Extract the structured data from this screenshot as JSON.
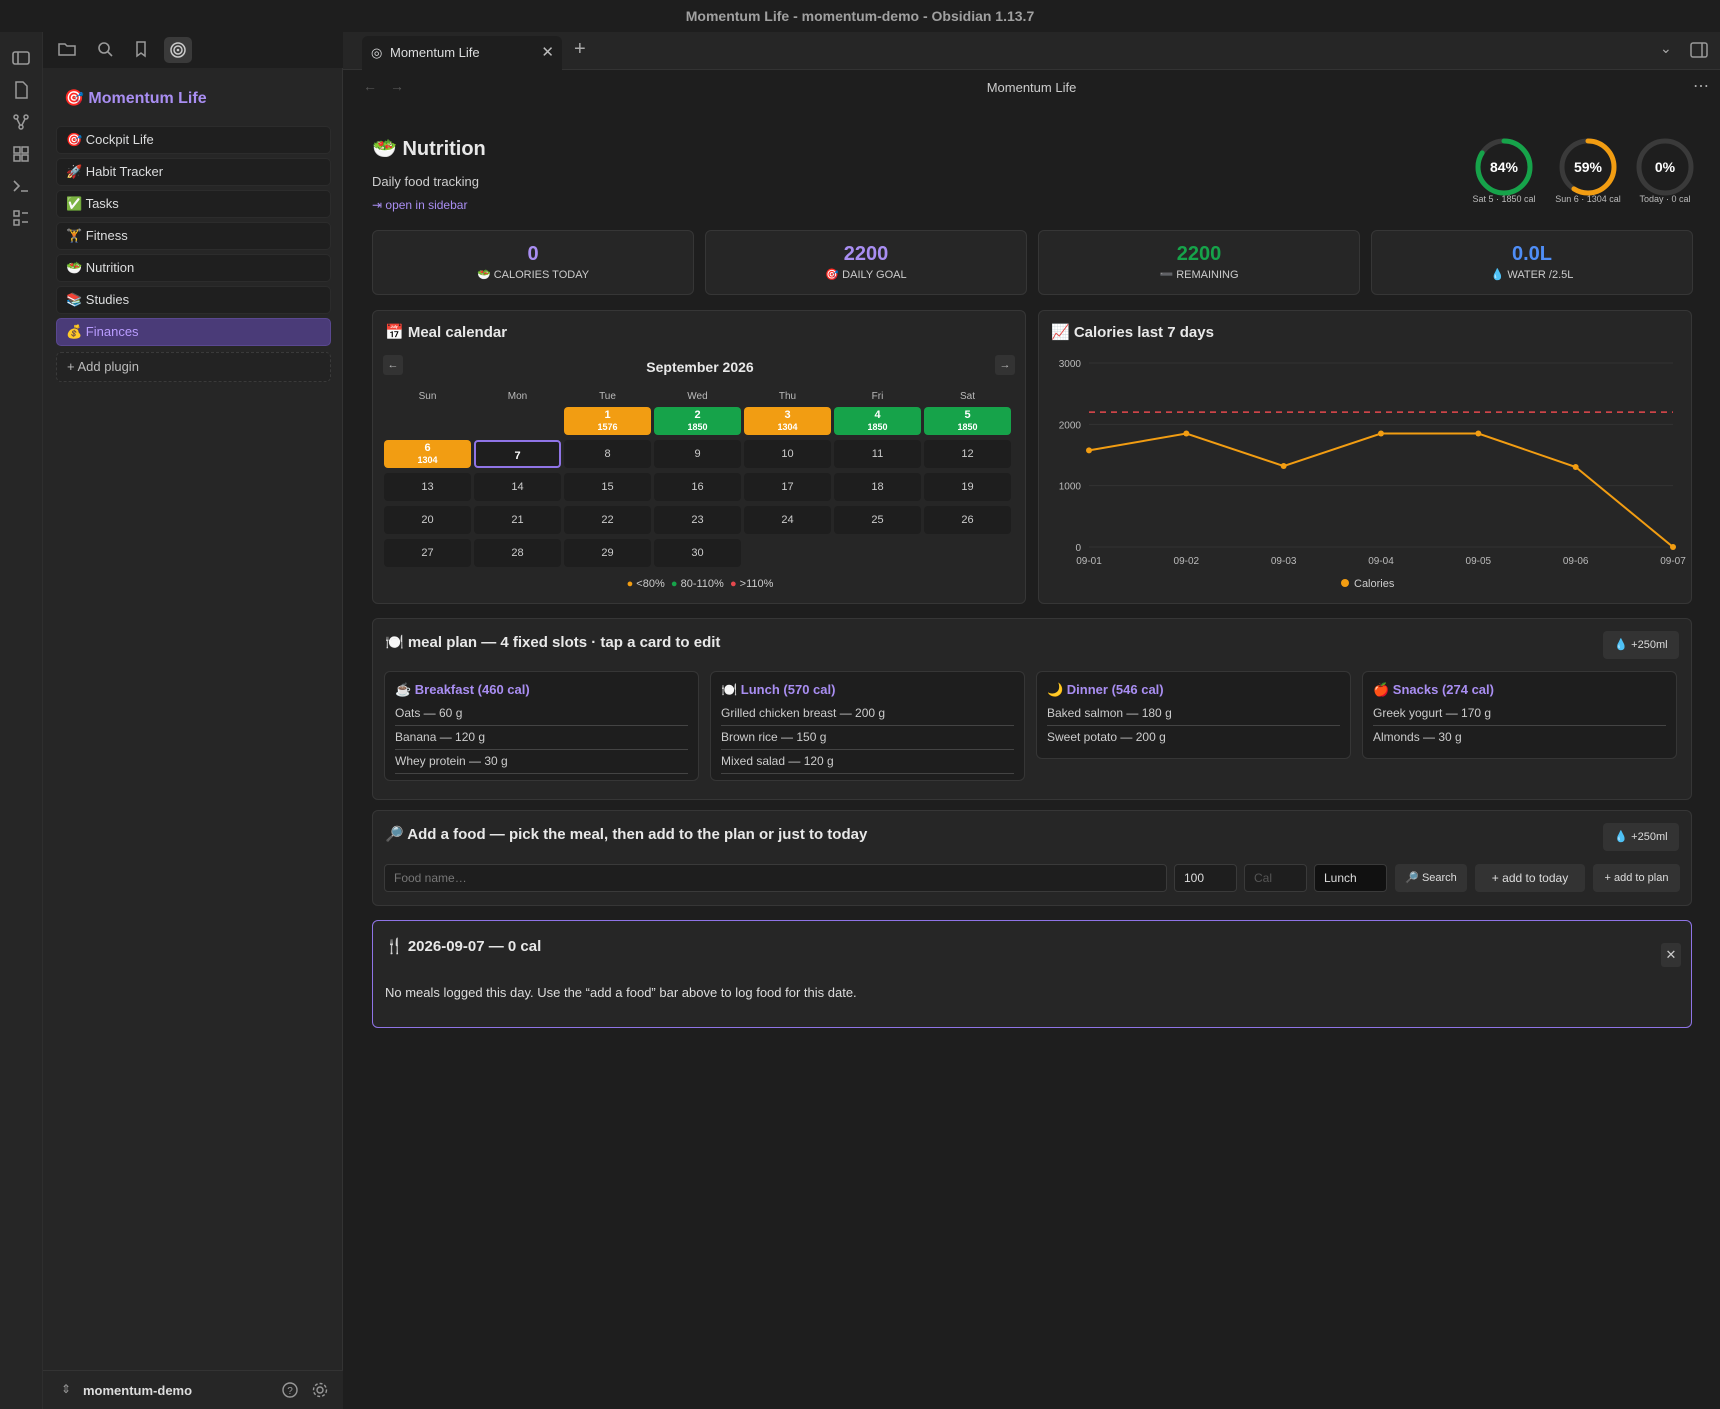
{
  "window": {
    "title": "Momentum Life - momentum-demo - Obsidian 1.13.7"
  },
  "tabs": [
    {
      "label": "Momentum Life"
    }
  ],
  "nav": {
    "title": "Momentum Life"
  },
  "sidebar": {
    "title": "🎯 Momentum Life",
    "items": [
      {
        "label": "🎯 Cockpit Life"
      },
      {
        "label": "🚀 Habit Tracker"
      },
      {
        "label": "✅ Tasks"
      },
      {
        "label": "🏋️ Fitness"
      },
      {
        "label": "🥗 Nutrition"
      },
      {
        "label": "📚 Studies"
      },
      {
        "label": "💰 Finances"
      }
    ],
    "add_label": "+ Add plugin",
    "vault": "momentum-demo"
  },
  "page": {
    "title": "🥗 Nutrition",
    "subtitle": "Daily food tracking",
    "open_link": "⇥ open in sidebar"
  },
  "rings": [
    {
      "pct": "84%",
      "value": 0.84,
      "label": "Sat 5 · 1850 cal",
      "color": "#16a34a"
    },
    {
      "pct": "59%",
      "value": 0.59,
      "label": "Sun 6 · 1304 cal",
      "color": "#f29d12"
    },
    {
      "pct": "0%",
      "value": 0,
      "label": "Today · 0 cal",
      "color": "#555555"
    }
  ],
  "stats": [
    {
      "value": "0",
      "label": "🥗 CALORIES TODAY",
      "color": "#a98ef2"
    },
    {
      "value": "2200",
      "label": "🎯 DAILY GOAL",
      "color": "#a98ef2"
    },
    {
      "value": "2200",
      "label": "➖ REMAINING",
      "color": "#16a34a"
    },
    {
      "value": "0.0L",
      "label": "💧 WATER /2.5L",
      "color": "#4f8ef7"
    }
  ],
  "calendar": {
    "title": "📅 Meal calendar",
    "month": "September 2026",
    "weekdays": [
      "Sun",
      "Mon",
      "Tue",
      "Wed",
      "Thu",
      "Fri",
      "Sat"
    ],
    "legend": [
      "<80%",
      "80-110%",
      ">110%"
    ]
  },
  "chart_data": {
    "type": "line",
    "title": "📈 Calories last 7 days",
    "x": [
      "09-01",
      "09-02",
      "09-03",
      "09-04",
      "09-05",
      "09-06",
      "09-07"
    ],
    "series": [
      {
        "name": "Calories",
        "values": [
          1576,
          1850,
          1320,
          1850,
          1850,
          1304,
          0
        ]
      }
    ],
    "goal": 2200,
    "ylim": [
      0,
      3000
    ],
    "yticks": [
      0,
      1000,
      2000,
      3000
    ],
    "colors": {
      "line": "#f29d12",
      "goal": "#e5484d"
    }
  },
  "mealplan": {
    "title": "🍽️ meal plan — 4 fixed slots · tap a card to edit",
    "water_btn": "💧 +250ml",
    "meals": [
      {
        "title": "☕ Breakfast (460 cal)",
        "items": [
          "Oats — 60 g",
          "Banana — 120 g",
          "Whey protein — 30 g"
        ]
      },
      {
        "title": "🍽️ Lunch (570 cal)",
        "items": [
          "Grilled chicken breast — 200 g",
          "Brown rice — 150 g",
          "Mixed salad — 120 g"
        ]
      },
      {
        "title": "🌙 Dinner (546 cal)",
        "items": [
          "Baked salmon — 180 g",
          "Sweet potato — 200 g"
        ]
      },
      {
        "title": "🍎 Snacks (274 cal)",
        "items": [
          "Greek yogurt — 170 g",
          "Almonds — 30 g"
        ]
      }
    ]
  },
  "addfood": {
    "title": "🔎 Add a food — pick the meal, then add to the plan or just to today",
    "water_btn": "💧 +250ml",
    "food_placeholder": "Food name…",
    "qty_value": "100",
    "cal_placeholder": "Cal",
    "meal_value": "Lunch",
    "search_btn": "🔎 Search",
    "today_btn": "+ add to today",
    "plan_btn": "+ add to plan"
  },
  "daylog": {
    "title": "🍴 2026-09-07 — 0 cal",
    "message": "No meals logged this day. Use the “add a food” bar above to log food for this date."
  }
}
